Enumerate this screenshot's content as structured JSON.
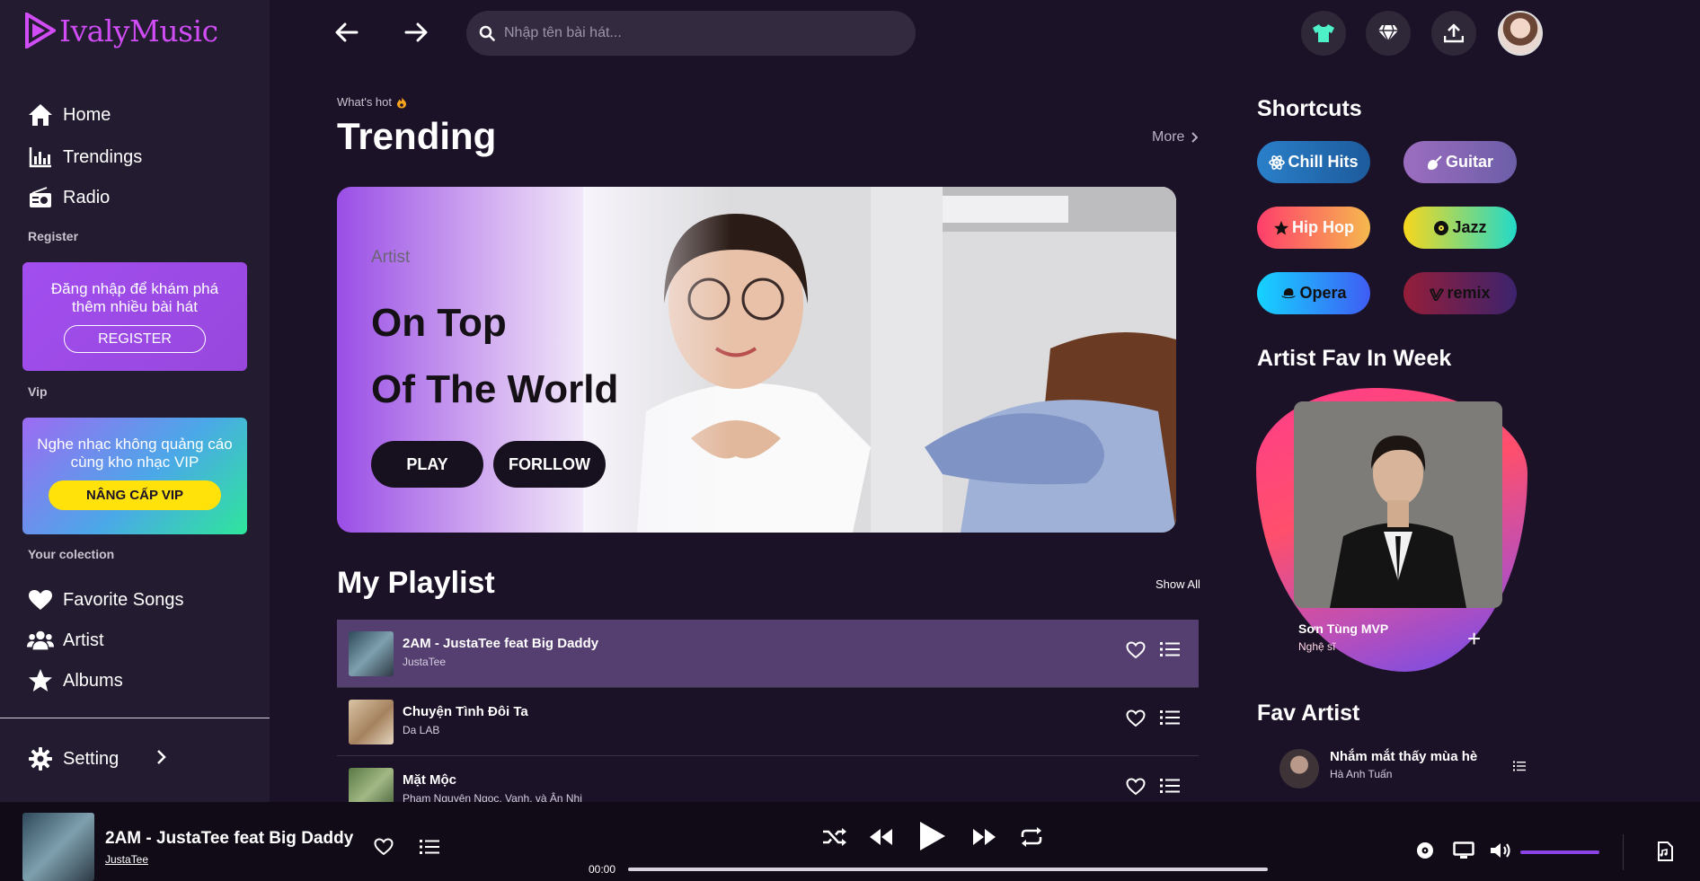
{
  "app": {
    "name": "IvalyMusic",
    "brand_color": "#d04cf5"
  },
  "sidebar": {
    "nav": [
      {
        "label": "Home",
        "icon": "home-icon"
      },
      {
        "label": "Trendings",
        "icon": "bar-chart-icon"
      },
      {
        "label": "Radio",
        "icon": "radio-icon"
      }
    ],
    "register_section": "Register",
    "register_promo": {
      "text": "Đăng nhập để khám phá thêm nhiều bài hát",
      "button": "REGISTER"
    },
    "vip_section": "Vip",
    "vip_promo": {
      "text": "Nghe nhạc không quảng cáo cùng kho nhạc VIP",
      "button": "NÂNG CẤP VIP"
    },
    "collection_section": "Your colection",
    "collection": [
      {
        "label": "Favorite Songs",
        "icon": "heart-icon"
      },
      {
        "label": "Artist",
        "icon": "users-icon"
      },
      {
        "label": "Albums",
        "icon": "star-icon"
      }
    ],
    "setting": {
      "label": "Setting",
      "icon": "gear-icon"
    }
  },
  "header": {
    "search_placeholder": "Nhập tên bài hát...",
    "actions": [
      "shirt-icon",
      "diamond-icon",
      "upload-icon",
      "avatar"
    ]
  },
  "trending": {
    "kicker": "What's hot",
    "title": "Trending",
    "more": "More",
    "hero": {
      "label": "Artist",
      "title_line1": "On Top",
      "title_line2": "Of The World",
      "play": "PLAY",
      "follow": "FORLLOW"
    }
  },
  "playlist": {
    "title": "My Playlist",
    "show_all": "Show All",
    "items": [
      {
        "title": "2AM - JustaTee feat Big Daddy",
        "artist": "JustaTee",
        "active": true
      },
      {
        "title": "Chuyện Tình Đôi Ta",
        "artist": "Da LAB",
        "active": false
      },
      {
        "title": "Mặt Mộc",
        "artist": "Phạm Nguyên Ngọc, Vanh, và Ân Nhi",
        "active": false
      }
    ]
  },
  "shortcuts": {
    "title": "Shortcuts",
    "items": [
      {
        "label": "Chill Hits",
        "icon": "atom-icon",
        "colors": [
          "#2a7fc9",
          "#1d5b9c"
        ]
      },
      {
        "label": "Guitar",
        "icon": "guitar-icon",
        "colors": [
          "#9c6dc0",
          "#6c5ea8"
        ]
      },
      {
        "label": "Hip Hop",
        "icon": "star-icon",
        "colors": [
          "#ff3e6c",
          "#f6b84e"
        ]
      },
      {
        "label": "Jazz",
        "icon": "record-icon",
        "colors": [
          "#f8d71d",
          "#22d9c8"
        ]
      },
      {
        "label": "Opera",
        "icon": "hat-icon",
        "colors": [
          "#15d3ff",
          "#3f5cf4"
        ]
      },
      {
        "label": "remix",
        "icon": "vimeo-icon",
        "colors": [
          "#951e39",
          "#3c236d"
        ]
      }
    ]
  },
  "artist_fav": {
    "title": "Artist Fav In Week",
    "name": "Sơn Tùng MVP",
    "role": "Nghệ sĩ",
    "add": "+"
  },
  "fav_artist": {
    "title": "Fav Artist",
    "items": [
      {
        "title": "Nhắm mắt thấy mùa hè",
        "artist": "Hà Anh Tuấn"
      }
    ]
  },
  "player": {
    "title": "2AM - JustaTee feat Big Daddy",
    "artist": "JustaTee",
    "time": "00:00",
    "progress": 0.0,
    "volume": 1.0
  }
}
